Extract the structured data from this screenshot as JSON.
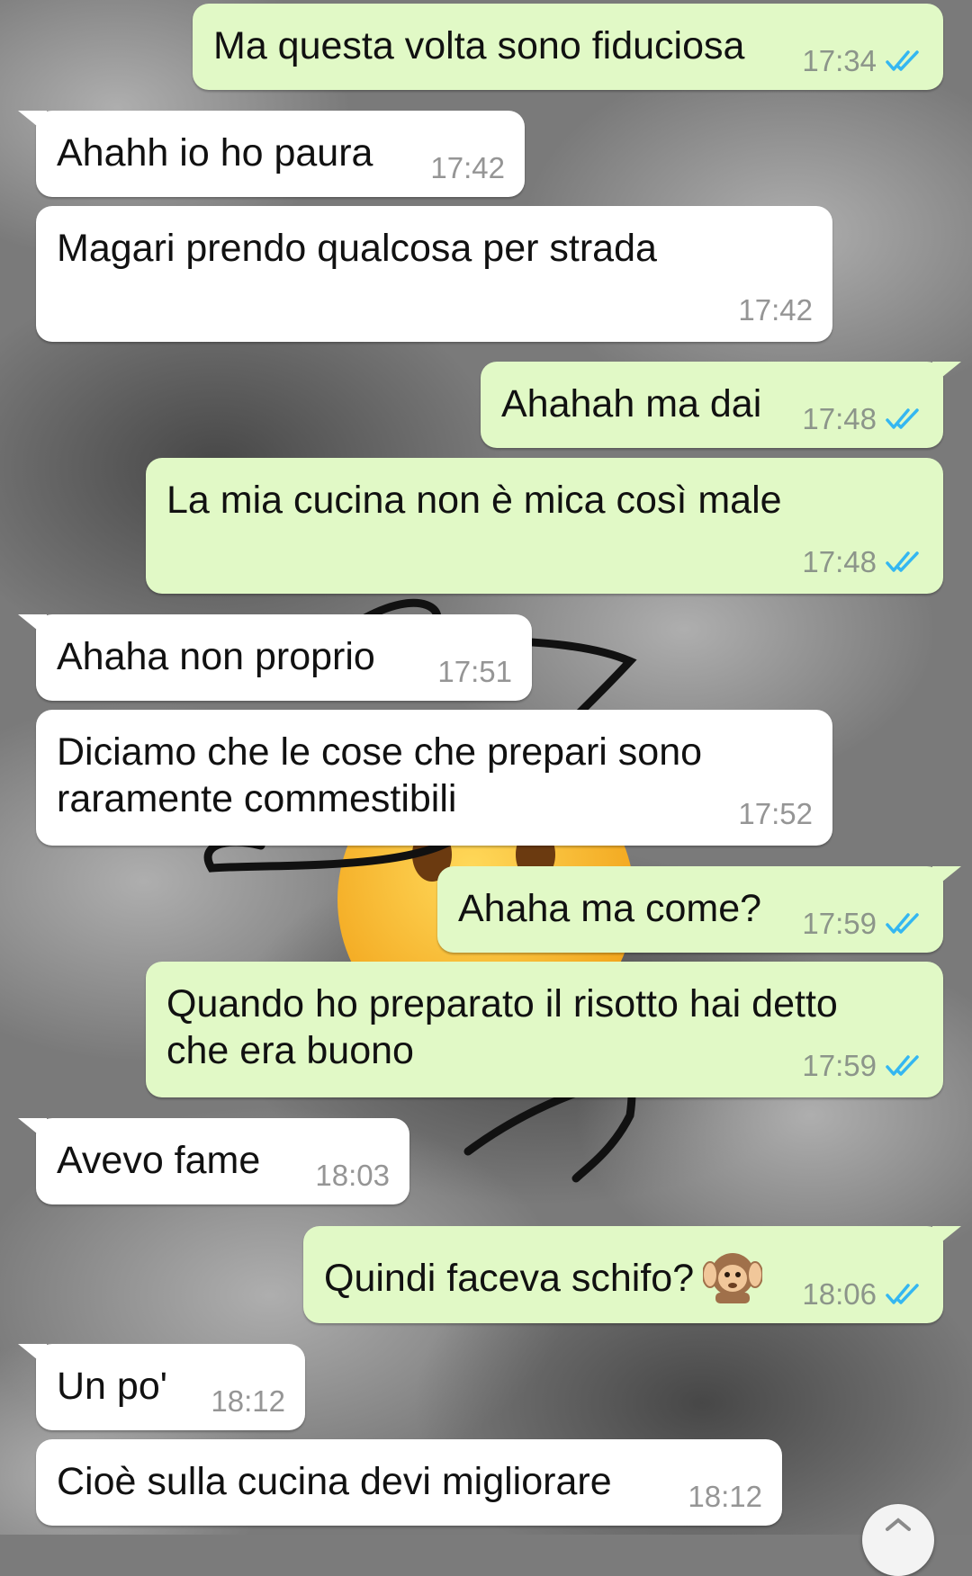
{
  "colors": {
    "incoming_bubble": "#ffffff",
    "outgoing_bubble": "#e1f9c6",
    "read_ticks": "#34b7f1",
    "timestamp": "#8c958a"
  },
  "messages": [
    {
      "direction": "outgoing",
      "lines": [
        "Ma questa volta sono fiduciosa"
      ],
      "time": "17:34",
      "status": "read",
      "tail": false
    },
    {
      "direction": "incoming",
      "lines": [
        "Ahahh io ho paura"
      ],
      "time": "17:42",
      "tail": true
    },
    {
      "direction": "incoming",
      "lines": [
        "Magari prendo qualcosa per strada"
      ],
      "time": "17:42",
      "tail": false
    },
    {
      "direction": "outgoing",
      "lines": [
        "Ahahah ma dai"
      ],
      "time": "17:48",
      "status": "read",
      "tail": true
    },
    {
      "direction": "outgoing",
      "lines": [
        "La mia cucina non è mica così male"
      ],
      "time": "17:48",
      "status": "read",
      "tail": false
    },
    {
      "direction": "incoming",
      "lines": [
        "Ahaha non proprio"
      ],
      "time": "17:51",
      "tail": true
    },
    {
      "direction": "incoming",
      "lines": [
        "Diciamo che le cose che prepari sono",
        "raramente commestibili"
      ],
      "time": "17:52",
      "tail": false
    },
    {
      "direction": "outgoing",
      "lines": [
        "Ahaha ma come?"
      ],
      "time": "17:59",
      "status": "read",
      "tail": true
    },
    {
      "direction": "outgoing",
      "lines": [
        "Quando ho preparato il risotto hai detto",
        "che era buono"
      ],
      "time": "17:59",
      "status": "read",
      "tail": false
    },
    {
      "direction": "incoming",
      "lines": [
        "Avevo fame"
      ],
      "time": "18:03",
      "tail": true
    },
    {
      "direction": "outgoing",
      "lines": [
        "Quindi faceva schifo?"
      ],
      "emoji": "hear-no-evil-monkey",
      "time": "18:06",
      "status": "read",
      "tail": true
    },
    {
      "direction": "incoming",
      "lines": [
        "Un po'"
      ],
      "time": "18:12",
      "tail": true
    },
    {
      "direction": "incoming",
      "lines": [
        "Cioè sulla cucina devi migliorare"
      ],
      "time": "18:12",
      "tail": false
    }
  ]
}
